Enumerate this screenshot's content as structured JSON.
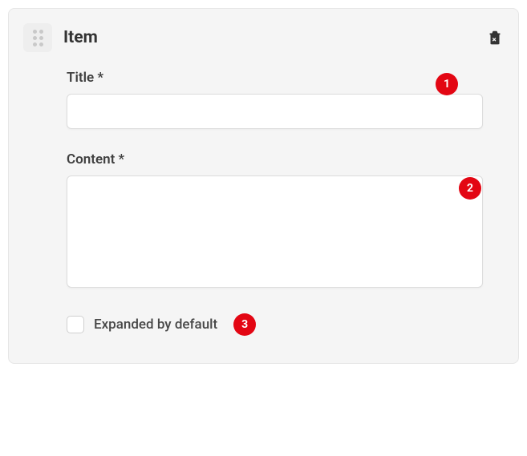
{
  "item": {
    "header": "Item",
    "fields": {
      "title": {
        "label": "Title *",
        "value": ""
      },
      "content": {
        "label": "Content *",
        "value": ""
      },
      "expanded": {
        "label": "Expanded by default",
        "checked": false
      }
    }
  },
  "annotations": {
    "a1": "1",
    "a2": "2",
    "a3": "3"
  }
}
